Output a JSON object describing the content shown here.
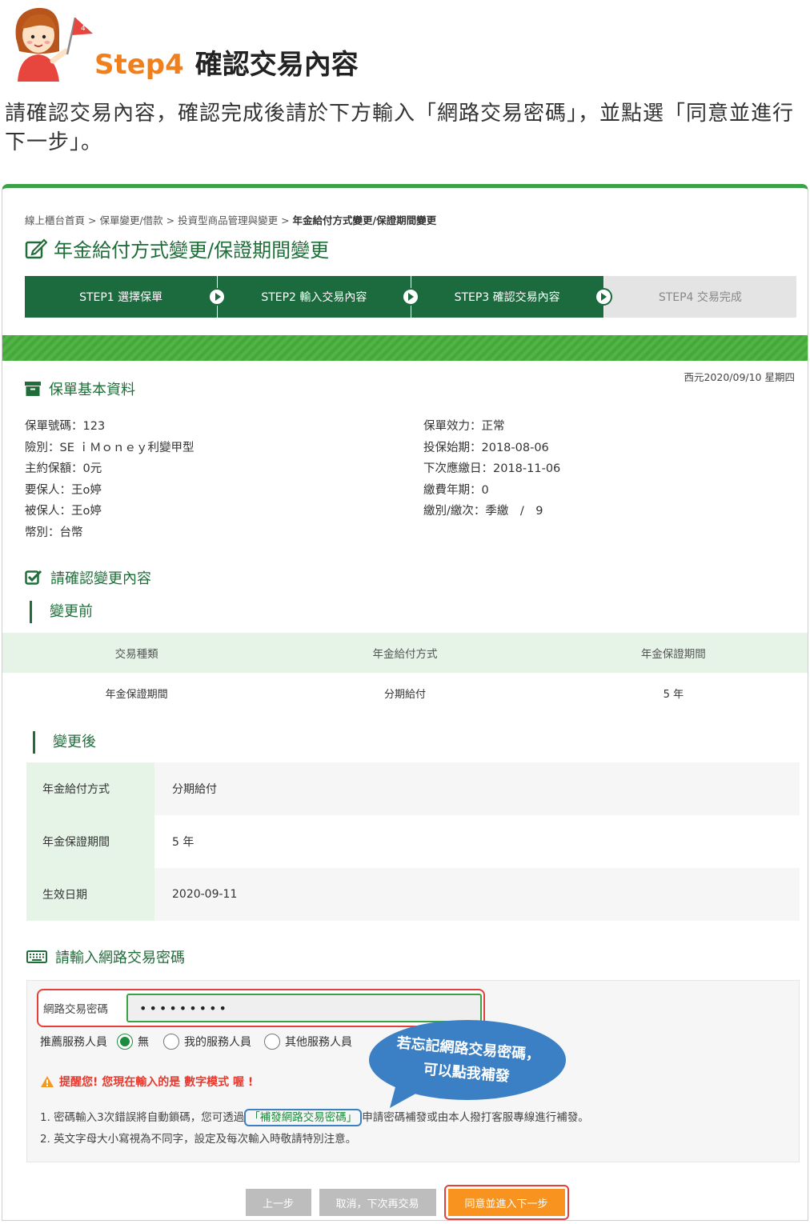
{
  "header": {
    "step_label": "Step4",
    "title": "確認交易內容",
    "badge_number": "4",
    "intro": "請確認交易內容，確認完成後請於下方輸入「網路交易密碼」，並點選「同意並進行下一步」。"
  },
  "breadcrumb": {
    "items": [
      "線上櫃台首頁",
      "保單變更/借款",
      "投資型商品管理與變更"
    ],
    "separator": " > ",
    "current": "年金給付方式變更/保證期間變更"
  },
  "page_title": "年金給付方式變更/保證期間變更",
  "stepper": [
    "STEP1 選擇保單",
    "STEP2 輸入交易內容",
    "STEP3 確認交易內容",
    "STEP4 交易完成"
  ],
  "date": "西元2020/09/10 星期四",
  "policy": {
    "title": "保單基本資料",
    "left": [
      "保單號碼：123",
      "險別：SE ｉＭｏｎｅｙ利變甲型",
      "主約保額：0元",
      "要保人：王o婷",
      "被保人：王o婷",
      "幣別：台幣"
    ],
    "right": [
      "保單效力：正常",
      "投保始期：2018-08-06",
      "下次應繳日：2018-11-06",
      "繳費年期：0",
      "繳別/繳次：季繳　/　9"
    ]
  },
  "confirm": {
    "title": "請確認變更內容",
    "before_title": "變更前",
    "before_headers": [
      "交易種類",
      "年金給付方式",
      "年金保證期間"
    ],
    "before_values": [
      "年金保證期間",
      "分期給付",
      "5 年"
    ],
    "after_title": "變更後",
    "after_rows": [
      {
        "label": "年金給付方式",
        "value": "分期給付"
      },
      {
        "label": "年金保證期間",
        "value": "5 年"
      },
      {
        "label": "生效日期",
        "value": "2020-09-11"
      }
    ]
  },
  "password": {
    "title": "請輸入網路交易密碼",
    "label": "網路交易密碼",
    "value": "•••••••••",
    "recommend_label": "推薦服務人員",
    "options": [
      "無",
      "我的服務人員",
      "其他服務人員"
    ],
    "selected": "無",
    "warning": "提醒您! 您現在輸入的是 數字模式 喔 !",
    "note1_pre": "1. 密碼輸入3次錯誤將自動鎖碼，您可透過",
    "note1_link": "「補發網路交易密碼」",
    "note1_post": "申請密碼補發或由本人撥打客服專線進行補發。",
    "note2": "2. 英文字母大小寫視為不同字，設定及每次輸入時敬請特別注意。"
  },
  "bubble": {
    "line1": "若忘記網路交易密碼，",
    "line2": "可以點我補發"
  },
  "buttons": {
    "prev": "上一步",
    "cancel": "取消，下次再交易",
    "next": "同意並進入下一步"
  },
  "colors": {
    "primary_green": "#1b6b3e",
    "accent_orange": "#f07f1c",
    "alert_red": "#e53f3a",
    "bubble_blue": "#3b7fc4"
  }
}
